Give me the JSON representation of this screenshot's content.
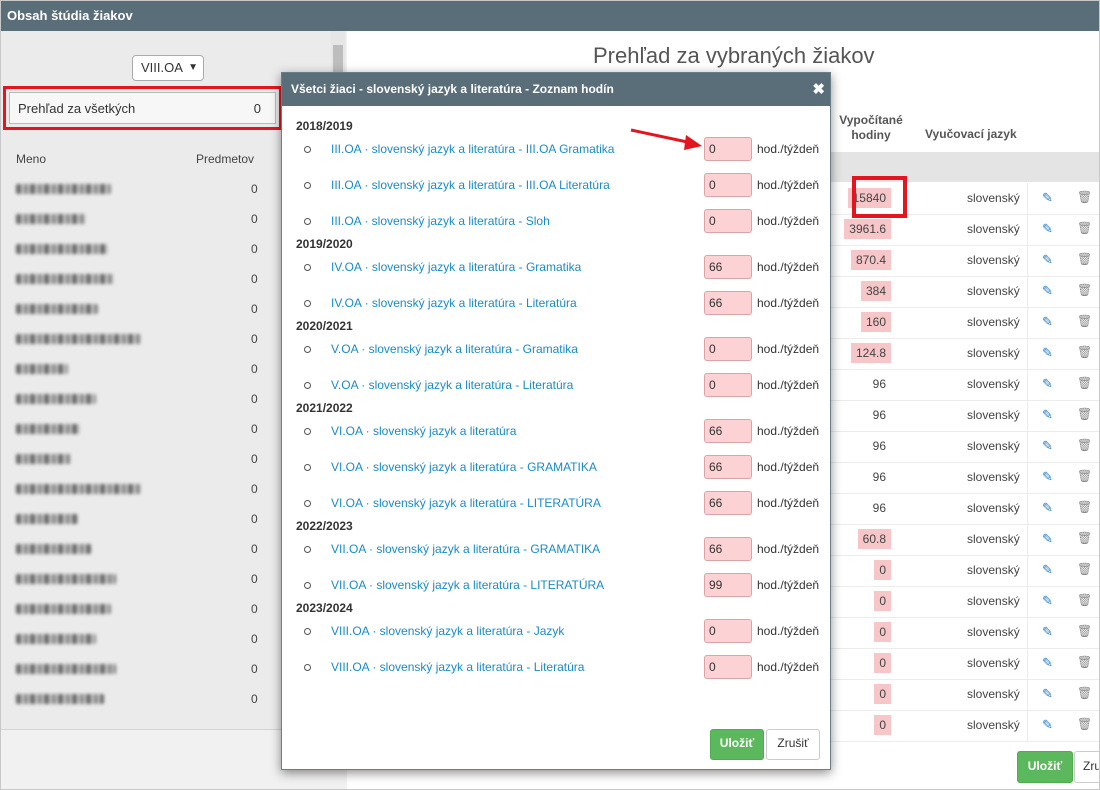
{
  "window": {
    "title": "Obsah štúdia žiakov"
  },
  "left": {
    "class_select": "VIII.OA",
    "all_students": {
      "label": "Prehľad za všetkých",
      "count": "0"
    },
    "col_name": "Meno",
    "col_subjects": "Predmetov",
    "students": [
      {
        "count": "0"
      },
      {
        "count": "0"
      },
      {
        "count": "0"
      },
      {
        "count": "0"
      },
      {
        "count": "0"
      },
      {
        "count": "0"
      },
      {
        "count": "0"
      },
      {
        "count": "0"
      },
      {
        "count": "0"
      },
      {
        "count": "0"
      },
      {
        "count": "0"
      },
      {
        "count": "0"
      },
      {
        "count": "0"
      },
      {
        "count": "0"
      },
      {
        "count": "0"
      },
      {
        "count": "0"
      },
      {
        "count": "0"
      },
      {
        "count": "0"
      }
    ]
  },
  "right": {
    "title": "Prehľad za vybraných žiakov",
    "col_hours": "Vypočítané hodiny",
    "col_lang": "Vyučovací jazyk",
    "rows": [
      {
        "hours": "15840",
        "lang": "slovenský",
        "pink": true
      },
      {
        "hours": "3961.6",
        "lang": "slovenský",
        "pink": true
      },
      {
        "hours": "870.4",
        "lang": "slovenský",
        "pink": true
      },
      {
        "hours": "384",
        "lang": "slovenský",
        "pink": true
      },
      {
        "hours": "160",
        "lang": "slovenský",
        "pink": true
      },
      {
        "hours": "124.8",
        "lang": "slovenský",
        "pink": true
      },
      {
        "hours": "96",
        "lang": "slovenský",
        "pink": false
      },
      {
        "hours": "96",
        "lang": "slovenský",
        "pink": false
      },
      {
        "hours": "96",
        "lang": "slovenský",
        "pink": false
      },
      {
        "hours": "96",
        "lang": "slovenský",
        "pink": false
      },
      {
        "hours": "96",
        "lang": "slovenský",
        "pink": false
      },
      {
        "hours": "60.8",
        "lang": "slovenský",
        "pink": true
      },
      {
        "hours": "0",
        "lang": "slovenský",
        "pink": true
      },
      {
        "hours": "0",
        "lang": "slovenský",
        "pink": true
      },
      {
        "hours": "0",
        "lang": "slovenský",
        "pink": true
      },
      {
        "hours": "0",
        "lang": "slovenský",
        "pink": true
      },
      {
        "hours": "0",
        "lang": "slovenský",
        "pink": true
      },
      {
        "hours": "0",
        "lang": "slovenský",
        "pink": true
      }
    ],
    "save": "Uložiť",
    "cancel": "Zrušiť"
  },
  "modal": {
    "title": "Všetci žiaci - slovenský jazyk a literatúra - Zoznam hodín",
    "close": "✖",
    "unit": "hod./týždeň",
    "save": "Uložiť",
    "cancel": "Zrušiť",
    "years": [
      {
        "label": "2018/2019",
        "lessons": [
          {
            "name": "III.OA · slovenský jazyk a literatúra - III.OA Gramatika",
            "hours": "0"
          },
          {
            "name": "III.OA · slovenský jazyk a literatúra - III.OA Literatúra",
            "hours": "0"
          },
          {
            "name": "III.OA · slovenský jazyk a literatúra - Sloh",
            "hours": "0"
          }
        ]
      },
      {
        "label": "2019/2020",
        "lessons": [
          {
            "name": "IV.OA · slovenský jazyk a literatúra - Gramatika",
            "hours": "66"
          },
          {
            "name": "IV.OA · slovenský jazyk a literatúra - Literatúra",
            "hours": "66"
          }
        ]
      },
      {
        "label": "2020/2021",
        "lessons": [
          {
            "name": "V.OA · slovenský jazyk a literatúra - Gramatika",
            "hours": "0"
          },
          {
            "name": "V.OA · slovenský jazyk a literatúra - Literatúra",
            "hours": "0"
          }
        ]
      },
      {
        "label": "2021/2022",
        "lessons": [
          {
            "name": "VI.OA · slovenský jazyk a literatúra",
            "hours": "66"
          },
          {
            "name": "VI.OA · slovenský jazyk a literatúra - GRAMATIKA",
            "hours": "66"
          },
          {
            "name": "VI.OA · slovenský jazyk a literatúra - LITERATÚRA",
            "hours": "66"
          }
        ]
      },
      {
        "label": "2022/2023",
        "lessons": [
          {
            "name": "VII.OA · slovenský jazyk a literatúra - GRAMATIKA",
            "hours": "66"
          },
          {
            "name": "VII.OA · slovenský jazyk a literatúra - LITERATÚRA",
            "hours": "99"
          }
        ]
      },
      {
        "label": "2023/2024",
        "lessons": [
          {
            "name": "VIII.OA · slovenský jazyk a literatúra - Jazyk",
            "hours": "0"
          },
          {
            "name": "VIII.OA · slovenský jazyk a literatúra - Literatúra",
            "hours": "0"
          }
        ]
      }
    ]
  },
  "colors": {
    "header": "#5a6e7a",
    "link": "#1a8bc8",
    "highlight": "#e4151f",
    "success": "#5cb85c",
    "pink": "#fdd2d5"
  }
}
